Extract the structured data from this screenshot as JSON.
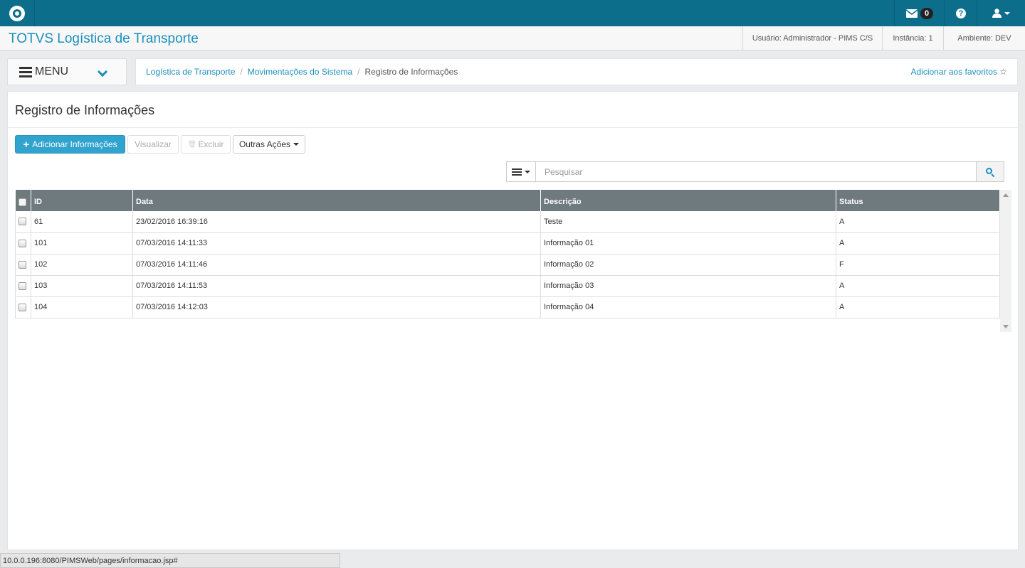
{
  "topbar": {
    "logo": "totvs-logo",
    "mail_icon": "envelope-icon",
    "mail_count": "0",
    "help_icon": "question-circle-icon",
    "help_glyph": "?",
    "user_icon": "user-icon"
  },
  "header": {
    "app_title": "TOTVS Logística de Transporte",
    "user": "Usuário: Administrador - PIMS C/S",
    "instance": "Instância: 1",
    "environment": "Ambiente: DEV"
  },
  "menu": {
    "label": "MENU"
  },
  "breadcrumb": {
    "items": [
      "Logística de Transporte",
      "Movimentações do Sistema"
    ],
    "separator": "/",
    "current": "Registro de Informações",
    "favorite": "Adicionar aos favoritos",
    "favorite_icon": "☆"
  },
  "page": {
    "title": "Registro de Informações"
  },
  "toolbar": {
    "add_icon": "+",
    "add_label": "Adicionar Informações",
    "view_label": "Visualizar",
    "delete_icon": "🗑",
    "delete_label": "Excluir",
    "more_label": "Outras Ações"
  },
  "search": {
    "placeholder": "Pesquisar",
    "value": ""
  },
  "table": {
    "columns": [
      "ID",
      "Data",
      "Descrição",
      "Status"
    ],
    "rows": [
      [
        "61",
        "23/02/2016 16:39:16",
        "Teste",
        "A"
      ],
      [
        "101",
        "07/03/2016 14:11:33",
        "Informação 01",
        "A"
      ],
      [
        "102",
        "07/03/2016 14:11:46",
        "Informação 02",
        "F"
      ],
      [
        "103",
        "07/03/2016 14:11:53",
        "Informação 03",
        "A"
      ],
      [
        "104",
        "07/03/2016 14:12:03",
        "Informação 04",
        "A"
      ]
    ]
  },
  "statusbar": {
    "url": "10.0.0.196:8080/PIMSWeb/pages/informacao.jsp#"
  },
  "colors": {
    "topbar": "#0c6e8a",
    "accent": "#1a8fbf",
    "primary_button": "#31a3cf",
    "grid_header": "#6f7a7e"
  }
}
